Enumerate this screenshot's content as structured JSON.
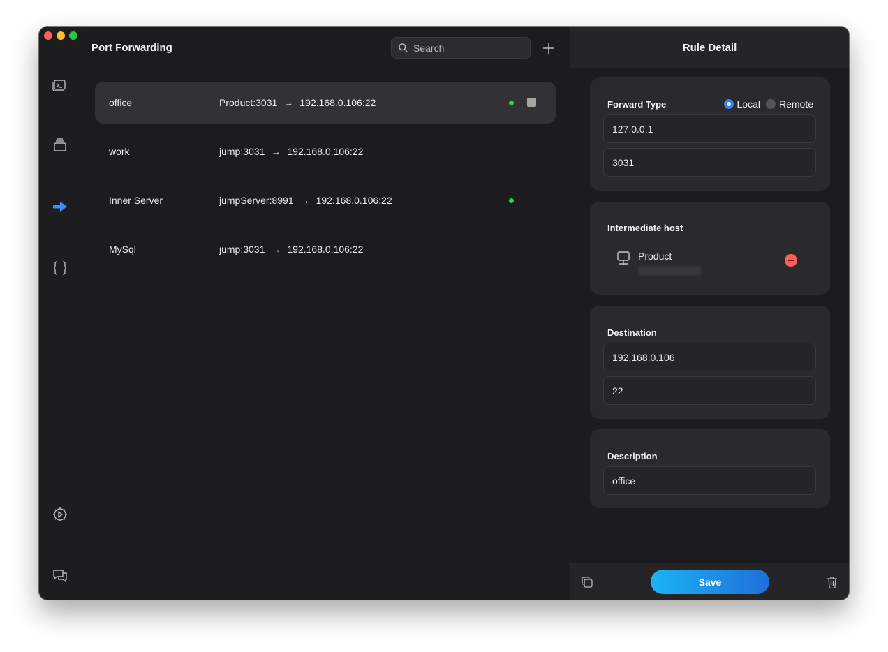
{
  "app": {
    "section_title": "Port Forwarding"
  },
  "search": {
    "placeholder": "Search",
    "value": ""
  },
  "rail": {
    "items": [
      {
        "icon": "terminal-icon"
      },
      {
        "icon": "stack-icon"
      },
      {
        "icon": "arrow-right-icon",
        "active": true,
        "color": "#3b8ef6"
      },
      {
        "icon": "braces-icon"
      },
      {
        "icon": "settings-icon"
      },
      {
        "icon": "chat-icon"
      }
    ]
  },
  "rules": [
    {
      "name": "office",
      "source": "Product:3031",
      "target": "192.168.0.106:22",
      "selected": true,
      "running": true,
      "show_stop": true
    },
    {
      "name": "work",
      "source": "jump:3031",
      "target": "192.168.0.106:22",
      "selected": false,
      "running": false
    },
    {
      "name": "Inner Server",
      "source": "jumpServer:8991",
      "target": "192.168.0.106:22",
      "selected": false,
      "running": true
    },
    {
      "name": "MySql",
      "source": "jump:3031",
      "target": "192.168.0.106:22",
      "selected": false,
      "running": false
    }
  ],
  "detail": {
    "title": "Rule Detail",
    "forward_type": {
      "label": "Forward Type",
      "options": [
        "Local",
        "Remote"
      ],
      "selected": "Local",
      "bind_host": "127.0.0.1",
      "bind_port": "3031"
    },
    "intermediate": {
      "label": "Intermediate host",
      "host_name": "Product"
    },
    "destination": {
      "label": "Destination",
      "host": "192.168.0.106",
      "port": "22"
    },
    "description": {
      "label": "Description",
      "value": "office"
    },
    "save_label": "Save"
  },
  "colors": {
    "accent": "#2d82f6",
    "running": "#30d158",
    "danger": "#ff5f57"
  }
}
